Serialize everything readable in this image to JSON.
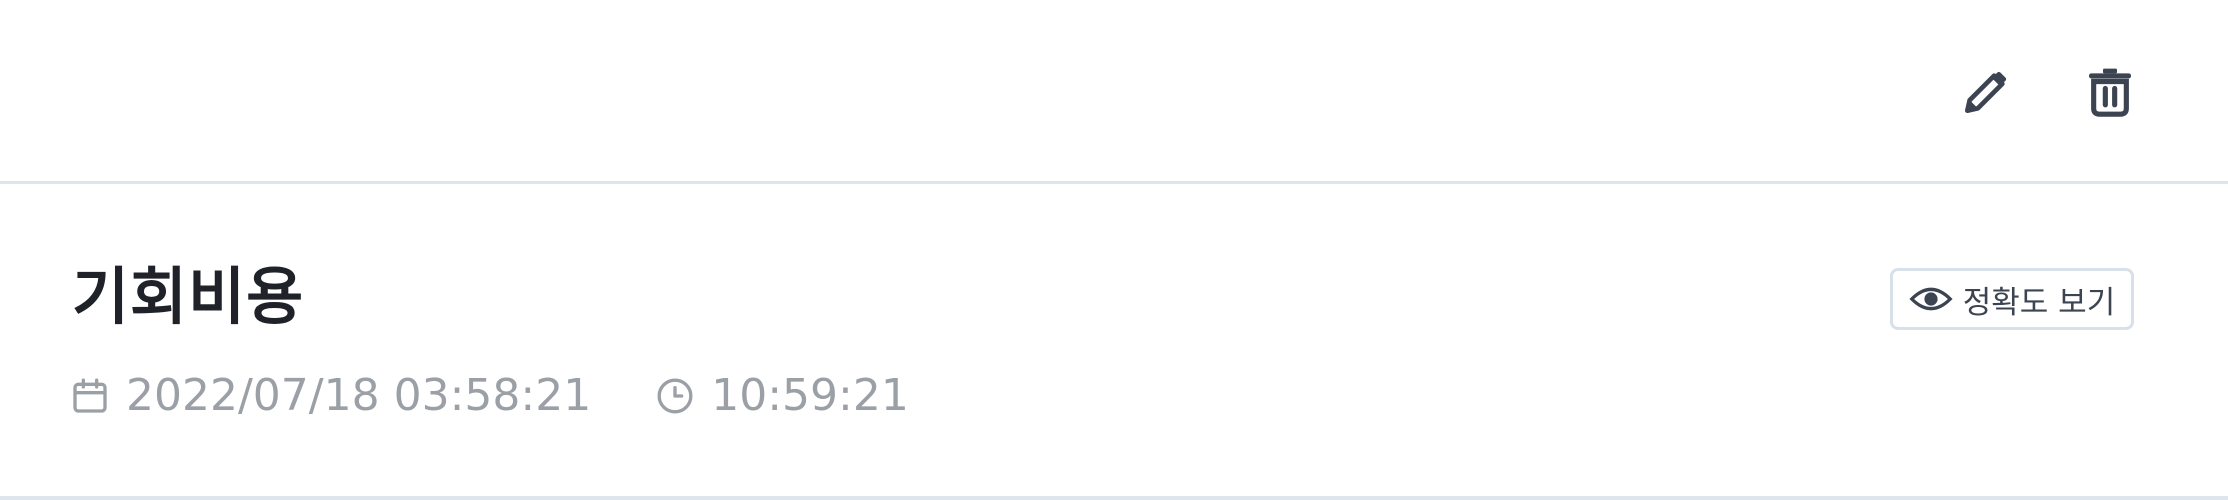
{
  "header": {
    "edit_icon": "pencil-icon",
    "delete_icon": "trash-icon"
  },
  "entry": {
    "title": "기회비용",
    "date": "2022/07/18 03:58:21",
    "duration": "10:59:21",
    "accuracy_button_label": "정확도 보기",
    "date_icon": "calendar-icon",
    "duration_icon": "clock-icon",
    "accuracy_icon": "eye-icon"
  },
  "colors": {
    "title": "#1f2329",
    "meta": "#9aa0a6",
    "icon": "#3b4450",
    "border": "#dfe5ec"
  }
}
